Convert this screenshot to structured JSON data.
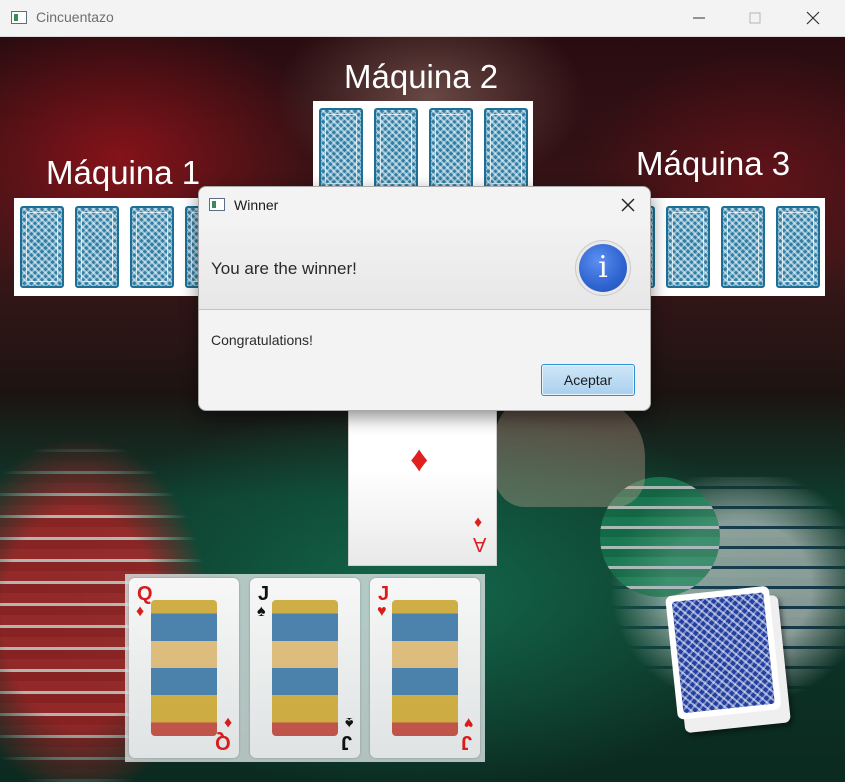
{
  "window": {
    "title": "Cincuentazo"
  },
  "machines": [
    {
      "label": "Máquina 1"
    },
    {
      "label": "Máquina 2"
    },
    {
      "label": "Máquina 3"
    }
  ],
  "table_card": {
    "rank": "A",
    "suit": "♦"
  },
  "player_hand": [
    {
      "rank": "Q",
      "suit": "♦",
      "color": "#d91d1d"
    },
    {
      "rank": "J",
      "suit": "♠",
      "color": "#111111"
    },
    {
      "rank": "J",
      "suit": "♥",
      "color": "#d91d1d"
    }
  ],
  "dialog": {
    "title": "Winner",
    "header": "You are the winner!",
    "content": "Congratulations!",
    "button_label": "Aceptar",
    "info_glyph": "i",
    "icon": "info-icon"
  },
  "colors": {
    "card_back": "#2f7fa6",
    "deck_back": "#2340a0",
    "button_border": "#2c8fd8"
  }
}
